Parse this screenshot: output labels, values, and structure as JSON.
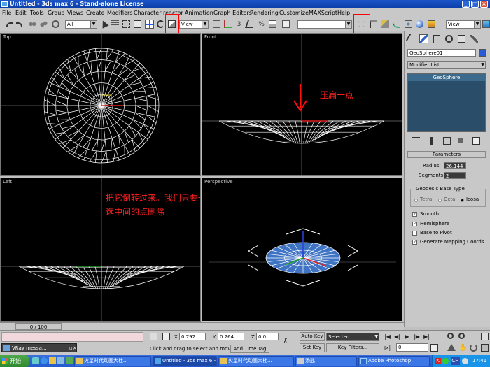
{
  "window": {
    "title": "Untitled - 3ds max 6 - Stand-alone License"
  },
  "menu": [
    "File",
    "Edit",
    "Tools",
    "Group",
    "Views",
    "Create",
    "Modifiers",
    "Character",
    "reactor",
    "Animation",
    "Graph Editors",
    "Rendering",
    "Customize",
    "MAXScript",
    "Help"
  ],
  "toolbar": {
    "selection_filter": "All",
    "ref_coord": "View",
    "named_sel": "",
    "view2": "View"
  },
  "viewports": {
    "top": "Top",
    "front": "Front",
    "left": "Left",
    "perspective": "Perspective"
  },
  "annotations": {
    "front": "压扁一点",
    "left_line1": "把它倒转过来。我们只要一个半球的薄片。 转换为POLY并",
    "left_line2": "选中间的点删除"
  },
  "panel": {
    "object_name": "GeoSphere01",
    "modifier_list": "Modifier List",
    "stack_item": "GeoSphere",
    "rollout": "Parameters",
    "radius_label": "Radius:",
    "radius_value": "26.144",
    "segments_label": "Segments:",
    "segments_value": "2",
    "base_type_label": "Geodesic Base Type",
    "base_types": [
      "Tetra",
      "Octa",
      "Icosa"
    ],
    "base_selected": "Icosa",
    "options": [
      {
        "label": "Smooth",
        "checked": true
      },
      {
        "label": "Hemisphere",
        "checked": true
      },
      {
        "label": "Base to Pivot",
        "checked": false
      },
      {
        "label": "Generate Mapping Coords.",
        "checked": true
      }
    ]
  },
  "timeline": {
    "slider": "0 / 100"
  },
  "status": {
    "vray_task": "VRay messa...",
    "x_label": "X",
    "x_value": "0.792",
    "y_label": "Y",
    "y_value": "0.264",
    "z_label": "Z",
    "z_value": "0.0",
    "prompt": "Click and drag to select and move",
    "add_time_tag": "Add Time Tag",
    "auto_key": "Auto Key",
    "set_key": "Set Key",
    "key_mode": "Selected",
    "key_filters": "Key Filters...",
    "frame": "0"
  },
  "taskbar": {
    "start": "开始",
    "items": [
      "火星时代动画大杜...",
      "Untitled - 3ds max 6 -...",
      "火星时代动画大杜...",
      "汤匙",
      "Adobe Photoshop"
    ],
    "lang": "CH",
    "clock": "17:41"
  },
  "colors": {
    "highlight_box": "#ff0000",
    "annotation": "#ff2020",
    "titlebar": "#0b3ea7"
  }
}
